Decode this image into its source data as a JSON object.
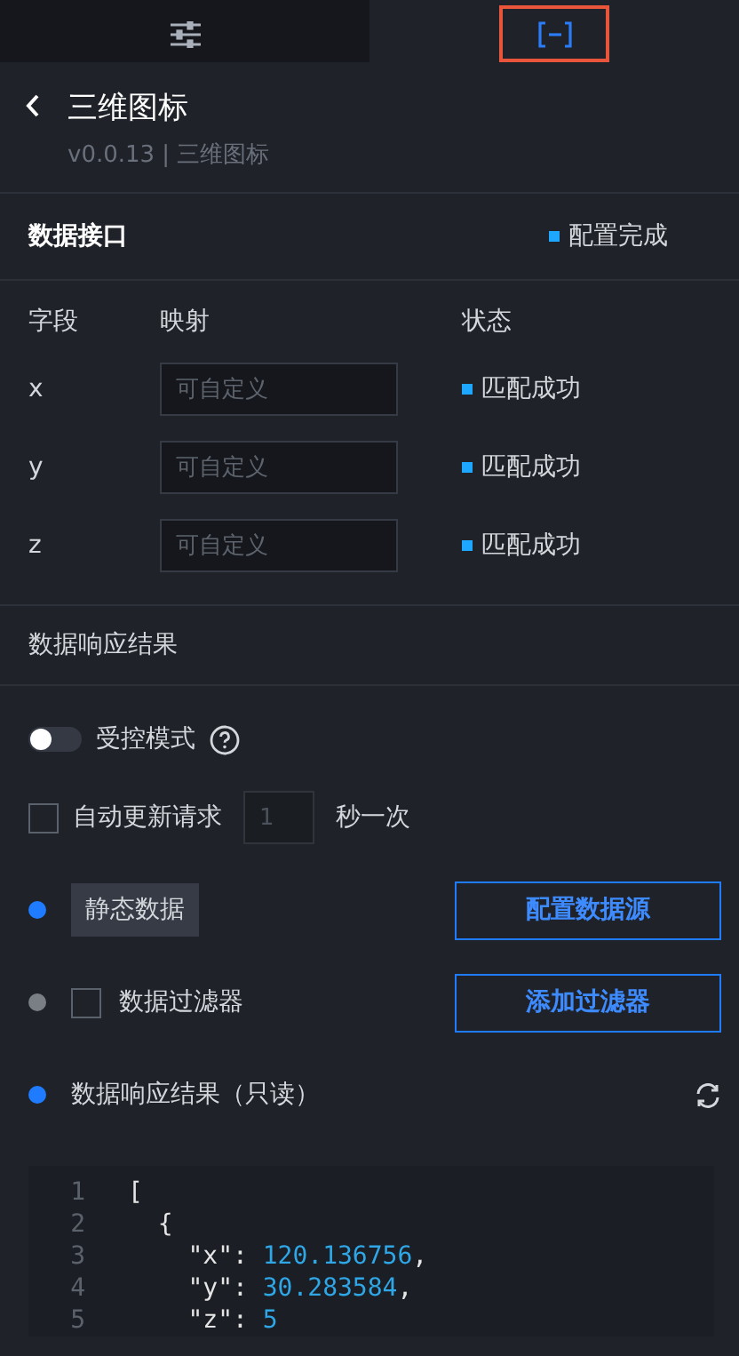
{
  "tabs": [
    {
      "kind": "settings",
      "selected": false
    },
    {
      "kind": "data",
      "selected": true
    }
  ],
  "header": {
    "title": "三维图标",
    "subtitle": "v0.0.13 | 三维图标"
  },
  "data_interface": {
    "title": "数据接口",
    "status": "配置完成"
  },
  "fields": {
    "columns": [
      "字段",
      "映射",
      "状态"
    ],
    "rows": [
      {
        "field": "x",
        "placeholder": "可自定义",
        "status": "匹配成功"
      },
      {
        "field": "y",
        "placeholder": "可自定义",
        "status": "匹配成功"
      },
      {
        "field": "z",
        "placeholder": "可自定义",
        "status": "匹配成功"
      }
    ]
  },
  "response_title": "数据响应结果",
  "controlled_mode": {
    "label": "受控模式",
    "on": false
  },
  "auto_update": {
    "label": "自动更新请求",
    "checked": false,
    "placeholder": "1",
    "unit": "秒一次"
  },
  "steps": [
    {
      "kind": "tag",
      "label": "静态数据",
      "active": true,
      "button": "配置数据源"
    },
    {
      "kind": "checkbox",
      "label": "数据过滤器",
      "active": false,
      "checked": false,
      "button": "添加过滤器"
    },
    {
      "kind": "result",
      "label": "数据响应结果（只读）",
      "active": true
    }
  ],
  "code": [
    {
      "number": "1",
      "text": "["
    },
    {
      "number": "2",
      "text": "  {"
    },
    {
      "number": "3",
      "text": "    \"x\": ",
      "value": "120.136756",
      "tail": ","
    },
    {
      "number": "4",
      "text": "    \"y\": ",
      "value": "30.283584",
      "tail": ","
    },
    {
      "number": "5",
      "text": "    \"z\": ",
      "value": "5"
    }
  ]
}
